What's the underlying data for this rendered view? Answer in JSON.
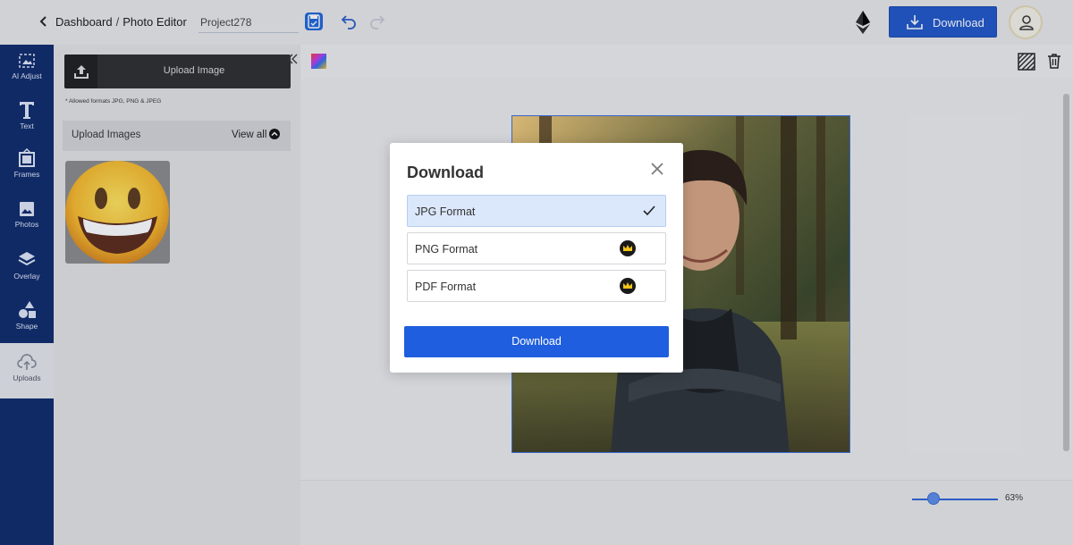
{
  "header": {
    "breadcrumb_dashboard": "Dashboard",
    "breadcrumb_separator": "/",
    "breadcrumb_current": "Photo Editor",
    "project_name": "Project278",
    "download_label": "Download"
  },
  "sidebar": {
    "items": [
      {
        "label": "AI Adjust",
        "icon": "ai-adjust-icon"
      },
      {
        "label": "Text",
        "icon": "text-icon"
      },
      {
        "label": "Frames",
        "icon": "frames-icon"
      },
      {
        "label": "Photos",
        "icon": "photos-icon"
      },
      {
        "label": "Overlay",
        "icon": "overlay-icon"
      },
      {
        "label": "Shape",
        "icon": "shape-icon"
      },
      {
        "label": "Uploads",
        "icon": "uploads-icon"
      }
    ],
    "active": "Uploads"
  },
  "panel": {
    "upload_button_label": "Upload Image",
    "allowed_formats": "* Allowed formats JPG, PNG & JPEG",
    "section_title": "Upload Images",
    "view_all_label": "View all"
  },
  "canvas": {
    "zoom_label": "63%",
    "zoom_percent": 63
  },
  "modal": {
    "title": "Download",
    "options": [
      {
        "label": "JPG Format",
        "selected": true,
        "premium": false
      },
      {
        "label": "PNG Format",
        "selected": false,
        "premium": true
      },
      {
        "label": "PDF Format",
        "selected": false,
        "premium": true
      }
    ],
    "download_button_label": "Download"
  },
  "colors": {
    "sidebar_bg": "#0d2a6a",
    "accent": "#1f5ede",
    "selected_option_bg": "#dbe7fb"
  }
}
